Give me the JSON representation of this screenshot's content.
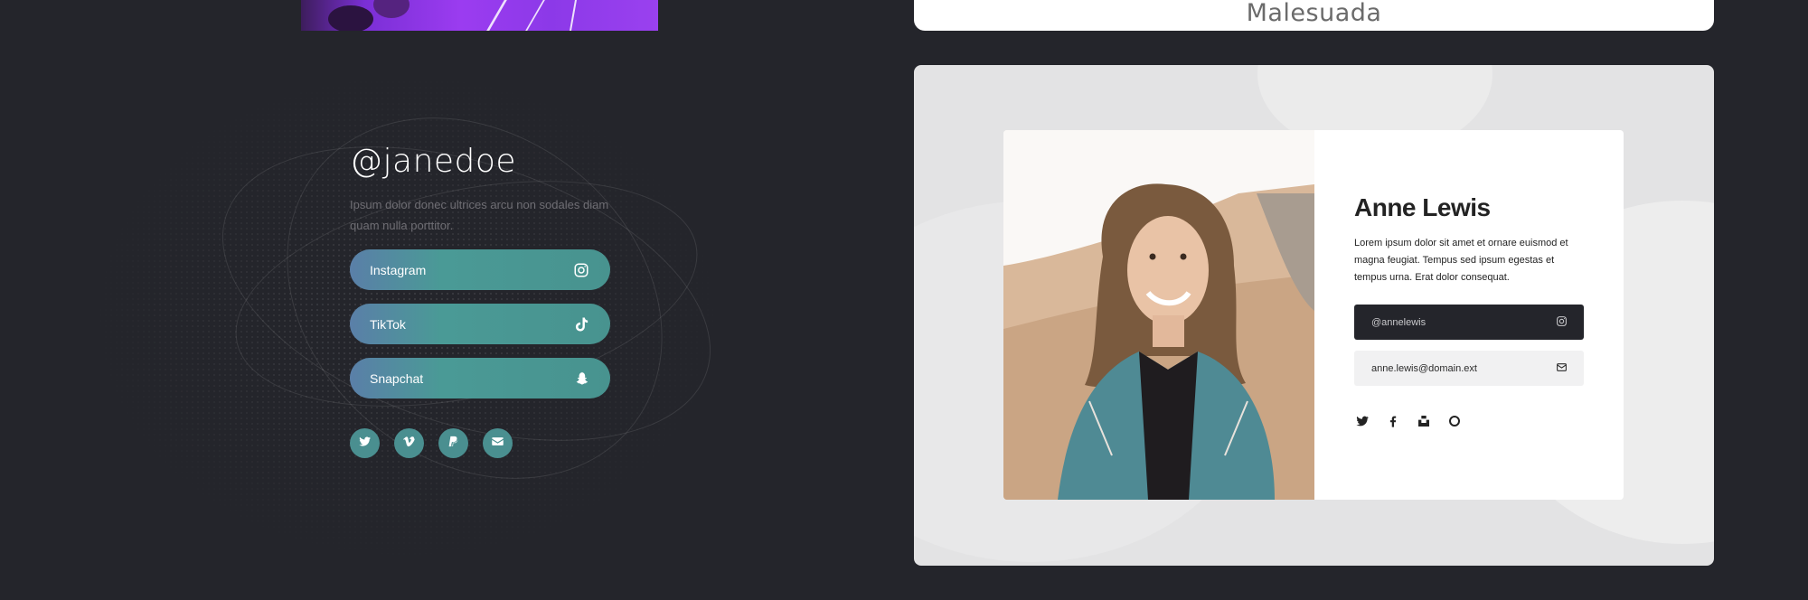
{
  "top": {
    "card_title": "Malesuada"
  },
  "left_profile": {
    "handle": "@janedoe",
    "description": "Ipsum dolor donec ultrices arcu non sodales diam quam nulla porttitor.",
    "links": [
      {
        "label": "Instagram",
        "icon": "instagram-icon"
      },
      {
        "label": "TikTok",
        "icon": "tiktok-icon"
      },
      {
        "label": "Snapchat",
        "icon": "snapchat-icon"
      }
    ],
    "social_icons": [
      "twitter-icon",
      "vimeo-icon",
      "paypal-icon",
      "email-icon"
    ]
  },
  "right_profile": {
    "name": "Anne Lewis",
    "bio": "Lorem ipsum dolor sit amet et ornare euismod et magna feugiat. Tempus sed ipsum egestas et tempus urna. Erat dolor consequat.",
    "instagram_handle": "@annelewis",
    "email": "anne.lewis@domain.ext",
    "social_icons": [
      "twitter-icon",
      "facebook-icon",
      "unsplash-icon",
      "500px-icon"
    ]
  },
  "colors": {
    "page_background": "#24252b",
    "pill_gradient_start": "#5a7fa8",
    "pill_gradient_end": "#48938f",
    "round_icon": "#4a8f90",
    "grey_card": "#e3e3e4",
    "dark_field": "#24252b"
  }
}
